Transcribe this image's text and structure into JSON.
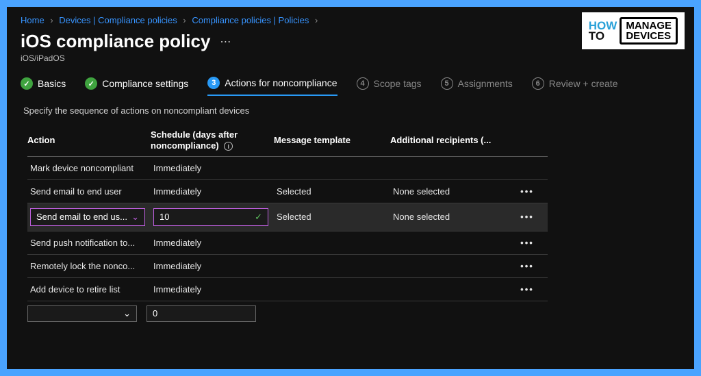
{
  "breadcrumb": {
    "home": "Home",
    "devices": "Devices | Compliance policies",
    "policies": "Compliance policies | Policies"
  },
  "title": "iOS compliance policy",
  "subtitle": "iOS/iPadOS",
  "wizard": {
    "s1": "Basics",
    "s2": "Compliance settings",
    "s3": "Actions for noncompliance",
    "s3num": "3",
    "s4": "Scope tags",
    "s4num": "4",
    "s5": "Assignments",
    "s5num": "5",
    "s6": "Review + create",
    "s6num": "6"
  },
  "description": "Specify the sequence of actions on noncompliant devices",
  "headers": {
    "action": "Action",
    "schedule": "Schedule (days after noncompliance)",
    "template": "Message template",
    "recipients": "Additional recipients (..."
  },
  "rows": [
    {
      "action": "Mark device noncompliant",
      "schedule": "Immediately",
      "template": "",
      "recipients": "",
      "menu": ""
    },
    {
      "action": "Send email to end user",
      "schedule": "Immediately",
      "template": "Selected",
      "recipients": "None selected",
      "menu": "•••"
    },
    {
      "action": "Send email to end us...",
      "schedule": "10",
      "template": "Selected",
      "recipients": "None selected",
      "menu": "•••",
      "editing": true
    },
    {
      "action": "Send push notification to...",
      "schedule": "Immediately",
      "template": "",
      "recipients": "",
      "menu": "•••"
    },
    {
      "action": "Remotely lock the nonco...",
      "schedule": "Immediately",
      "template": "",
      "recipients": "",
      "menu": "•••"
    },
    {
      "action": "Add device to retire list",
      "schedule": "Immediately",
      "template": "",
      "recipients": "",
      "menu": "•••"
    }
  ],
  "new_row": {
    "schedule_default": "0"
  },
  "logo": {
    "how": "HOW",
    "to": "TO",
    "manage": "MANAGE",
    "devices": "DEVICES"
  }
}
